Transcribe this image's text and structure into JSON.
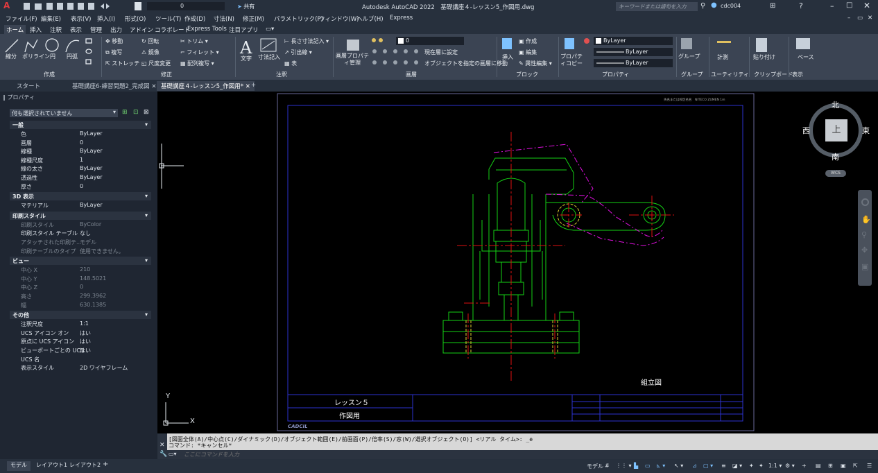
{
  "app": {
    "title": "Autodesk AutoCAD 2022　基礎講座４-レッスン5_作図用.dwg",
    "logo": "A",
    "layer_value": "0",
    "share_label": "共有",
    "search_placeholder": "キーワードまたは語句を入力",
    "user": "cdc004"
  },
  "menu": [
    "ファイル(F)",
    "編集(E)",
    "表示(V)",
    "挿入(I)",
    "形式(O)",
    "ツール(T)",
    "作成(D)",
    "寸法(N)",
    "修正(M)",
    "パラメトリック(P)",
    "ウィンドウ(W)",
    "ヘルプ(H)",
    "Express"
  ],
  "ribbon_tabs": [
    "ホーム",
    "挿入",
    "注釈",
    "表示",
    "管理",
    "出力",
    "アドイン",
    "コラボレート",
    "Express Tools",
    "注目アプリ"
  ],
  "ribbon": {
    "draw": {
      "line": "線分",
      "polyline": "ポリライン",
      "circle": "円",
      "arc": "円弧",
      "panel": "作成"
    },
    "modify": {
      "move": "移動",
      "rotate": "回転",
      "trim": "トリム",
      "copy": "複写",
      "mirror": "鏡像",
      "fillet": "フィレット",
      "stretch": "ストレッチ",
      "scale": "尺度変更",
      "array": "配列複写",
      "panel": "修正"
    },
    "annotation": {
      "text": "文字",
      "dimension": "寸法記入",
      "linear": "長さ寸法記入",
      "leader": "引出線",
      "table": "表",
      "panel": "注釈"
    },
    "layers": {
      "props": "画層プロパティ管理",
      "layer": "0",
      "make_current": "現在層に設定",
      "match": "オブジェクトを指定の画層に移動",
      "panel": "画層"
    },
    "block": {
      "insert": "挿入",
      "create": "作成",
      "edit": "編集",
      "attr": "属性編集",
      "panel": "ブロック"
    },
    "properties": {
      "match": "プロパティコピー",
      "color": "ByLayer",
      "linetype": "ByLayer",
      "lineweight": "ByLayer",
      "panel": "プロパティ"
    },
    "groups": {
      "group": "グループ",
      "panel": "グループ"
    },
    "utilities": {
      "measure": "計測",
      "panel": "ユーティリティ"
    },
    "clipboard": {
      "paste": "貼り付け",
      "panel": "クリップボード"
    },
    "view": {
      "base": "ベース",
      "panel": "表示"
    }
  },
  "doc_tabs": [
    "スタート",
    "基礎講座6-練習問題2_完成図",
    "基礎講座４-レッスン5_作図用*"
  ],
  "palette": {
    "title": "プロパティ",
    "selection": "何も選択されていません",
    "sections": [
      {
        "name": "一般",
        "rows": [
          {
            "k": "色",
            "v": "ByLayer"
          },
          {
            "k": "画層",
            "v": "0"
          },
          {
            "k": "線種",
            "v": "ByLayer"
          },
          {
            "k": "線種尺度",
            "v": "1"
          },
          {
            "k": "線の太さ",
            "v": "ByLayer"
          },
          {
            "k": "透過性",
            "v": "ByLayer"
          },
          {
            "k": "厚さ",
            "v": "0"
          }
        ]
      },
      {
        "name": "3D 表示",
        "rows": [
          {
            "k": "マテリアル",
            "v": "ByLayer"
          }
        ]
      },
      {
        "name": "印刷スタイル",
        "rows": [
          {
            "k": "印刷スタイル",
            "v": "ByColor"
          },
          {
            "k": "印刷スタイル テーブル",
            "v": "なし"
          },
          {
            "k": "アタッチされた印刷テ...",
            "v": "モデル"
          },
          {
            "k": "印刷テーブルのタイプ",
            "v": "使用できません。"
          }
        ]
      },
      {
        "name": "ビュー",
        "rows": [
          {
            "k": "中心 X",
            "v": "210"
          },
          {
            "k": "中心 Y",
            "v": "148.5021"
          },
          {
            "k": "中心 Z",
            "v": "0"
          },
          {
            "k": "高さ",
            "v": "299.3962"
          },
          {
            "k": "幅",
            "v": "630.1385"
          }
        ]
      },
      {
        "name": "その他",
        "rows": [
          {
            "k": "注釈尺度",
            "v": "1:1"
          },
          {
            "k": "UCS アイコン オン",
            "v": "はい"
          },
          {
            "k": "原点に UCS アイコン",
            "v": "はい"
          },
          {
            "k": "ビューポートごとの UCS",
            "v": "はい"
          },
          {
            "k": "UCS 名",
            "v": ""
          },
          {
            "k": "表示スタイル",
            "v": "2D ワイヤフレーム"
          }
        ]
      }
    ]
  },
  "viewcube": {
    "n": "北",
    "s": "南",
    "e": "東",
    "w": "西",
    "face": "上",
    "wcs": "WCS"
  },
  "drawing": {
    "tb_lesson": "レッスン５",
    "tb_purpose": "作図用",
    "label": "組立図",
    "logo": "CADCIL",
    "header": "氏名または校区名名　NITECO ZUMEN 1m"
  },
  "ucs": {
    "x": "X",
    "y": "Y"
  },
  "command": {
    "history": "[図面全体(A)/中心点(C)/ダイナミック(D)/オブジェクト範囲(E)/前画面(P)/倍率(S)/窓(W)/選択オブジェクト(O)] <リアル タイム>: _e",
    "history2": "コマンド: *キャンセル*",
    "placeholder": "ここにコマンドを入力"
  },
  "layout_tabs": [
    "モデル",
    "レイアウト1",
    "レイアウト2"
  ],
  "status": {
    "model": "モデル",
    "scale": "1:1"
  }
}
